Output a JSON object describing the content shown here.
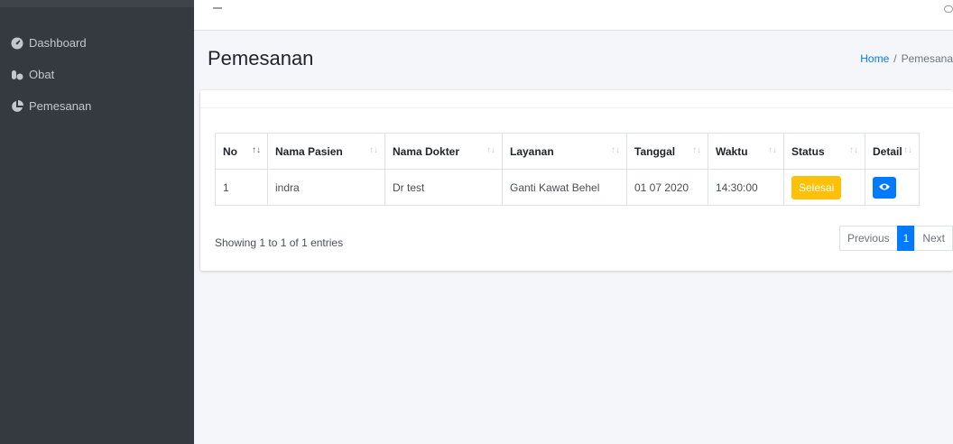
{
  "sidebar": {
    "items": [
      {
        "label": "Dashboard",
        "icon": "dashboard-gauge-icon"
      },
      {
        "label": "Obat",
        "icon": "pills-icon"
      },
      {
        "label": "Pemesanan",
        "icon": "chart-pie-icon"
      }
    ]
  },
  "header": {
    "title": "Pemesanan",
    "breadcrumb": {
      "home": "Home",
      "separator": "/",
      "current": "Pemesana"
    }
  },
  "table": {
    "columns": [
      "No",
      "Nama Pasien",
      "Nama Dokter",
      "Layanan",
      "Tanggal",
      "Waktu",
      "Status",
      "Detail"
    ],
    "rows": [
      {
        "no": "1",
        "pasien": "indra",
        "dokter": "Dr test",
        "layanan": "Ganti Kawat Behel",
        "tanggal": "01 07 2020",
        "waktu": "14:30:00",
        "status": "Selesai"
      }
    ],
    "info": "Showing 1 to 1 of 1 entries",
    "pagination": {
      "previous": "Previous",
      "page": "1",
      "next": "Next"
    }
  },
  "colors": {
    "sidebar_bg": "#343a40",
    "primary": "#007bff",
    "warning": "#ffc107"
  }
}
